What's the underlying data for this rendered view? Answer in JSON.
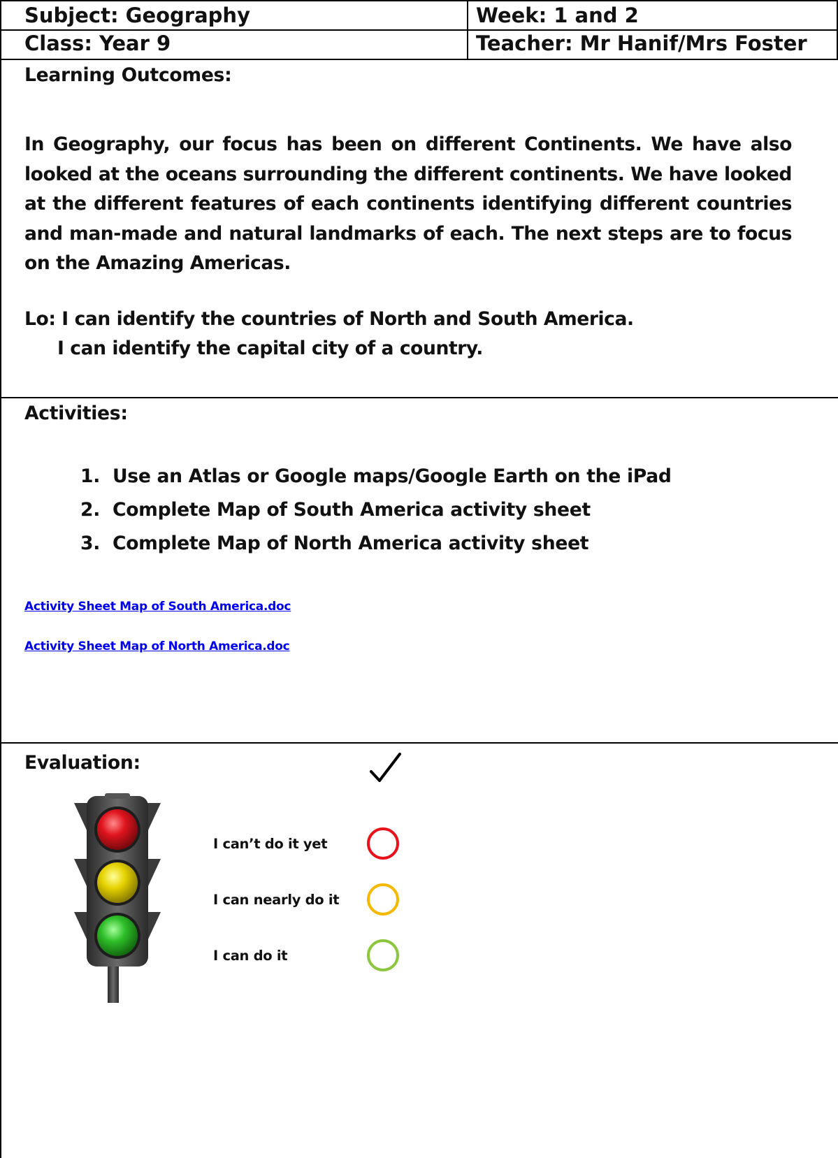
{
  "header": {
    "subject": "Subject: Geography",
    "week": "Week: 1 and 2",
    "class": "Class: Year 9",
    "teacher": "Teacher: Mr Hanif/Mrs Foster"
  },
  "learning": {
    "title": "Learning Outcomes:",
    "paragraph": "In Geography, our focus has been on different Continents. We have also looked at the oceans surrounding the different continents.  We have looked at the different features of each continents identifying different countries and man-made and natural landmarks of each.  The next steps are to focus on the Amazing Americas.",
    "lo_line1": "Lo: I can identify the countries of North and South America.",
    "lo_line2": "I can identify the capital city of a country."
  },
  "activities": {
    "title": "Activities:",
    "items": [
      {
        "num": "1.",
        "text": "Use an Atlas or Google maps/Google Earth on the iPad"
      },
      {
        "num": "2.",
        "text": "Complete Map of South America activity sheet"
      },
      {
        "num": "3.",
        "text": "Complete Map of North America activity sheet"
      }
    ],
    "links": [
      "Activity Sheet Map of South America.doc",
      "Activity Sheet Map of North America.doc"
    ]
  },
  "evaluation": {
    "title": "Evaluation:",
    "levels": [
      {
        "label": "I can’t do it yet",
        "color": "#e8121b"
      },
      {
        "label": "I can nearly do it",
        "color": "#f5b800"
      },
      {
        "label": "I can do it",
        "color": "#8cc63f"
      }
    ],
    "traffic_light": {
      "red": "#d8141e",
      "amber": "#e6d200",
      "green": "#2fbf2a",
      "body": "#4a4a4a"
    }
  }
}
